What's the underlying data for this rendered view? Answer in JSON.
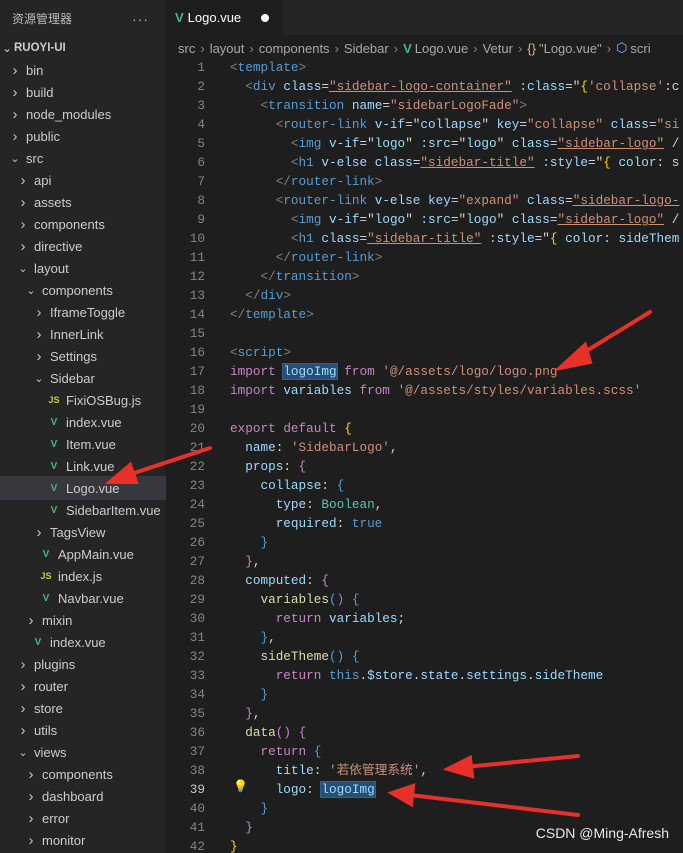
{
  "sidebar": {
    "title": "资源管理器",
    "more": "···",
    "root": "RUOYI-UI",
    "tree": [
      {
        "label": "bin",
        "depth": 1,
        "type": "folder"
      },
      {
        "label": "build",
        "depth": 1,
        "type": "folder"
      },
      {
        "label": "node_modules",
        "depth": 1,
        "type": "folder"
      },
      {
        "label": "public",
        "depth": 1,
        "type": "folder"
      },
      {
        "label": "src",
        "depth": 1,
        "type": "open"
      },
      {
        "label": "api",
        "depth": 2,
        "type": "folder"
      },
      {
        "label": "assets",
        "depth": 2,
        "type": "folder"
      },
      {
        "label": "components",
        "depth": 2,
        "type": "folder"
      },
      {
        "label": "directive",
        "depth": 2,
        "type": "folder"
      },
      {
        "label": "layout",
        "depth": 2,
        "type": "open"
      },
      {
        "label": "components",
        "depth": 3,
        "type": "open"
      },
      {
        "label": "IframeToggle",
        "depth": 4,
        "type": "folder"
      },
      {
        "label": "InnerLink",
        "depth": 4,
        "type": "folder"
      },
      {
        "label": "Settings",
        "depth": 4,
        "type": "folder"
      },
      {
        "label": "Sidebar",
        "depth": 4,
        "type": "open"
      },
      {
        "label": "FixiOSBug.js",
        "depth": 5,
        "type": "js"
      },
      {
        "label": "index.vue",
        "depth": 5,
        "type": "vue"
      },
      {
        "label": "Item.vue",
        "depth": 5,
        "type": "vue"
      },
      {
        "label": "Link.vue",
        "depth": 5,
        "type": "vue"
      },
      {
        "label": "Logo.vue",
        "depth": 5,
        "type": "vue",
        "selected": true
      },
      {
        "label": "SidebarItem.vue",
        "depth": 5,
        "type": "vue"
      },
      {
        "label": "TagsView",
        "depth": 4,
        "type": "folder"
      },
      {
        "label": "AppMain.vue",
        "depth": 4,
        "type": "vue"
      },
      {
        "label": "index.js",
        "depth": 4,
        "type": "js"
      },
      {
        "label": "Navbar.vue",
        "depth": 4,
        "type": "vue"
      },
      {
        "label": "mixin",
        "depth": 3,
        "type": "folder"
      },
      {
        "label": "index.vue",
        "depth": 3,
        "type": "vue"
      },
      {
        "label": "plugins",
        "depth": 2,
        "type": "folder"
      },
      {
        "label": "router",
        "depth": 2,
        "type": "folder"
      },
      {
        "label": "store",
        "depth": 2,
        "type": "folder"
      },
      {
        "label": "utils",
        "depth": 2,
        "type": "folder"
      },
      {
        "label": "views",
        "depth": 2,
        "type": "open"
      },
      {
        "label": "components",
        "depth": 3,
        "type": "folder"
      },
      {
        "label": "dashboard",
        "depth": 3,
        "type": "folder"
      },
      {
        "label": "error",
        "depth": 3,
        "type": "folder"
      },
      {
        "label": "monitor",
        "depth": 3,
        "type": "folder"
      }
    ]
  },
  "tab": {
    "label": "Logo.vue",
    "modified": true
  },
  "breadcrumb": [
    "src",
    "layout",
    "components",
    "Sidebar",
    "Logo.vue",
    "Vetur",
    "\"Logo.vue\"",
    "scri"
  ],
  "editor": {
    "current_line": 39,
    "lines": [
      [
        [
          "p",
          "<"
        ],
        [
          "t",
          "template"
        ],
        [
          "p",
          ">"
        ]
      ],
      [
        [
          "n",
          "  "
        ],
        [
          "p",
          "<"
        ],
        [
          "t",
          "div"
        ],
        [
          "n",
          " "
        ],
        [
          "a",
          "class"
        ],
        [
          "n",
          "="
        ],
        [
          "s",
          "\"sidebar-logo-container\"",
          "u"
        ],
        [
          "n",
          " "
        ],
        [
          "a",
          ":class"
        ],
        [
          "n",
          "=\""
        ],
        [
          "b",
          "{"
        ],
        [
          "s",
          "'collapse'"
        ],
        [
          "n",
          ":c"
        ]
      ],
      [
        [
          "n",
          "    "
        ],
        [
          "p",
          "<"
        ],
        [
          "t",
          "transition"
        ],
        [
          "n",
          " "
        ],
        [
          "a",
          "name"
        ],
        [
          "n",
          "="
        ],
        [
          "s",
          "\"sidebarLogoFade\""
        ],
        [
          "p",
          ">"
        ]
      ],
      [
        [
          "n",
          "      "
        ],
        [
          "p",
          "<"
        ],
        [
          "t",
          "router-link"
        ],
        [
          "n",
          " "
        ],
        [
          "a",
          "v-if"
        ],
        [
          "n",
          "=\""
        ],
        [
          "v",
          "collapse"
        ],
        [
          "n",
          "\" "
        ],
        [
          "a",
          "key"
        ],
        [
          "n",
          "="
        ],
        [
          "s",
          "\"collapse\""
        ],
        [
          "n",
          " "
        ],
        [
          "a",
          "class"
        ],
        [
          "n",
          "="
        ],
        [
          "s",
          "\"si"
        ]
      ],
      [
        [
          "n",
          "        "
        ],
        [
          "p",
          "<"
        ],
        [
          "t",
          "img"
        ],
        [
          "n",
          " "
        ],
        [
          "a",
          "v-if"
        ],
        [
          "n",
          "=\""
        ],
        [
          "v",
          "logo"
        ],
        [
          "n",
          "\" "
        ],
        [
          "a",
          ":src"
        ],
        [
          "n",
          "=\""
        ],
        [
          "v",
          "logo"
        ],
        [
          "n",
          "\" "
        ],
        [
          "a",
          "class"
        ],
        [
          "n",
          "="
        ],
        [
          "s",
          "\"sidebar-logo\"",
          "u"
        ],
        [
          "n",
          " /"
        ]
      ],
      [
        [
          "n",
          "        "
        ],
        [
          "p",
          "<"
        ],
        [
          "t",
          "h1"
        ],
        [
          "n",
          " "
        ],
        [
          "a",
          "v-else"
        ],
        [
          "n",
          " "
        ],
        [
          "a",
          "class"
        ],
        [
          "n",
          "="
        ],
        [
          "s",
          "\"sidebar-title\"",
          "u"
        ],
        [
          "n",
          " "
        ],
        [
          "a",
          ":style"
        ],
        [
          "n",
          "=\""
        ],
        [
          "b",
          "{"
        ],
        [
          "n",
          " "
        ],
        [
          "v",
          "color"
        ],
        [
          "n",
          ": s"
        ]
      ],
      [
        [
          "n",
          "      "
        ],
        [
          "p",
          "</"
        ],
        [
          "t",
          "router-link"
        ],
        [
          "p",
          ">"
        ]
      ],
      [
        [
          "n",
          "      "
        ],
        [
          "p",
          "<"
        ],
        [
          "t",
          "router-link"
        ],
        [
          "n",
          " "
        ],
        [
          "a",
          "v-else"
        ],
        [
          "n",
          " "
        ],
        [
          "a",
          "key"
        ],
        [
          "n",
          "="
        ],
        [
          "s",
          "\"expand\""
        ],
        [
          "n",
          " "
        ],
        [
          "a",
          "class"
        ],
        [
          "n",
          "="
        ],
        [
          "s",
          "\"sidebar-logo-",
          "u"
        ]
      ],
      [
        [
          "n",
          "        "
        ],
        [
          "p",
          "<"
        ],
        [
          "t",
          "img"
        ],
        [
          "n",
          " "
        ],
        [
          "a",
          "v-if"
        ],
        [
          "n",
          "=\""
        ],
        [
          "v",
          "logo"
        ],
        [
          "n",
          "\" "
        ],
        [
          "a",
          ":src"
        ],
        [
          "n",
          "=\""
        ],
        [
          "v",
          "logo"
        ],
        [
          "n",
          "\" "
        ],
        [
          "a",
          "class"
        ],
        [
          "n",
          "="
        ],
        [
          "s",
          "\"sidebar-logo\"",
          "u"
        ],
        [
          "n",
          " /"
        ]
      ],
      [
        [
          "n",
          "        "
        ],
        [
          "p",
          "<"
        ],
        [
          "t",
          "h1"
        ],
        [
          "n",
          " "
        ],
        [
          "a",
          "class"
        ],
        [
          "n",
          "="
        ],
        [
          "s",
          "\"sidebar-title\"",
          "u"
        ],
        [
          "n",
          " "
        ],
        [
          "a",
          ":style"
        ],
        [
          "n",
          "=\""
        ],
        [
          "b",
          "{"
        ],
        [
          "n",
          " "
        ],
        [
          "v",
          "color"
        ],
        [
          "n",
          ": "
        ],
        [
          "v",
          "sideThem"
        ]
      ],
      [
        [
          "n",
          "      "
        ],
        [
          "p",
          "</"
        ],
        [
          "t",
          "router-link"
        ],
        [
          "p",
          ">"
        ]
      ],
      [
        [
          "n",
          "    "
        ],
        [
          "p",
          "</"
        ],
        [
          "t",
          "transition"
        ],
        [
          "p",
          ">"
        ]
      ],
      [
        [
          "n",
          "  "
        ],
        [
          "p",
          "</"
        ],
        [
          "t",
          "div"
        ],
        [
          "p",
          ">"
        ]
      ],
      [
        [
          "p",
          "</"
        ],
        [
          "t",
          "template"
        ],
        [
          "p",
          ">"
        ]
      ],
      [],
      [
        [
          "p",
          "<"
        ],
        [
          "t",
          "script"
        ],
        [
          "p",
          ">"
        ]
      ],
      [
        [
          "k",
          "import"
        ],
        [
          "n",
          " "
        ],
        [
          "v",
          "logoImg",
          "hl"
        ],
        [
          "n",
          " "
        ],
        [
          "k",
          "from"
        ],
        [
          "n",
          " "
        ],
        [
          "s",
          "'@/assets/logo/logo.png'"
        ]
      ],
      [
        [
          "k",
          "import"
        ],
        [
          "n",
          " "
        ],
        [
          "v",
          "variables"
        ],
        [
          "n",
          " "
        ],
        [
          "k",
          "from"
        ],
        [
          "n",
          " "
        ],
        [
          "s",
          "'@/assets/styles/variables.scss'"
        ]
      ],
      [],
      [
        [
          "k",
          "export"
        ],
        [
          "n",
          " "
        ],
        [
          "k",
          "default"
        ],
        [
          "n",
          " "
        ],
        [
          "b",
          "{"
        ]
      ],
      [
        [
          "n",
          "  "
        ],
        [
          "v",
          "name"
        ],
        [
          "n",
          ": "
        ],
        [
          "s",
          "'SidebarLogo'"
        ],
        [
          "n",
          ","
        ]
      ],
      [
        [
          "n",
          "  "
        ],
        [
          "v",
          "props"
        ],
        [
          "n",
          ": "
        ],
        [
          "k",
          "{"
        ]
      ],
      [
        [
          "n",
          "    "
        ],
        [
          "v",
          "collapse"
        ],
        [
          "n",
          ": "
        ],
        [
          "t",
          "{"
        ]
      ],
      [
        [
          "n",
          "      "
        ],
        [
          "v",
          "type"
        ],
        [
          "n",
          ": "
        ],
        [
          "c",
          "Boolean"
        ],
        [
          "n",
          ","
        ]
      ],
      [
        [
          "n",
          "      "
        ],
        [
          "v",
          "required"
        ],
        [
          "n",
          ": "
        ],
        [
          "bl",
          "true"
        ]
      ],
      [
        [
          "n",
          "    "
        ],
        [
          "t",
          "}"
        ]
      ],
      [
        [
          "n",
          "  "
        ],
        [
          "k",
          "}"
        ],
        [
          "n",
          ","
        ]
      ],
      [
        [
          "n",
          "  "
        ],
        [
          "v",
          "computed"
        ],
        [
          "n",
          ": "
        ],
        [
          "k",
          "{"
        ]
      ],
      [
        [
          "n",
          "    "
        ],
        [
          "f",
          "variables"
        ],
        [
          "t",
          "()"
        ],
        [
          "n",
          " "
        ],
        [
          "t",
          "{"
        ]
      ],
      [
        [
          "n",
          "      "
        ],
        [
          "k",
          "return"
        ],
        [
          "n",
          " "
        ],
        [
          "v",
          "variables"
        ],
        [
          "n",
          ";"
        ]
      ],
      [
        [
          "n",
          "    "
        ],
        [
          "t",
          "}"
        ],
        [
          "n",
          ","
        ]
      ],
      [
        [
          "n",
          "    "
        ],
        [
          "f",
          "sideTheme"
        ],
        [
          "t",
          "()"
        ],
        [
          "n",
          " "
        ],
        [
          "t",
          "{"
        ]
      ],
      [
        [
          "n",
          "      "
        ],
        [
          "k",
          "return"
        ],
        [
          "n",
          " "
        ],
        [
          "bl",
          "this"
        ],
        [
          "n",
          "."
        ],
        [
          "v",
          "$store"
        ],
        [
          "n",
          "."
        ],
        [
          "v",
          "state"
        ],
        [
          "n",
          "."
        ],
        [
          "v",
          "settings"
        ],
        [
          "n",
          "."
        ],
        [
          "v",
          "sideTheme"
        ]
      ],
      [
        [
          "n",
          "    "
        ],
        [
          "t",
          "}"
        ]
      ],
      [
        [
          "n",
          "  "
        ],
        [
          "k",
          "}"
        ],
        [
          "n",
          ","
        ]
      ],
      [
        [
          "n",
          "  "
        ],
        [
          "f",
          "data"
        ],
        [
          "k",
          "()"
        ],
        [
          "n",
          " "
        ],
        [
          "k",
          "{"
        ]
      ],
      [
        [
          "n",
          "    "
        ],
        [
          "k",
          "return"
        ],
        [
          "n",
          " "
        ],
        [
          "t",
          "{"
        ]
      ],
      [
        [
          "n",
          "      "
        ],
        [
          "v",
          "title"
        ],
        [
          "n",
          ": "
        ],
        [
          "s",
          "'若依管理系统'"
        ],
        [
          "n",
          ","
        ]
      ],
      [
        [
          "n",
          "      "
        ],
        [
          "v",
          "logo"
        ],
        [
          "n",
          ": "
        ],
        [
          "v",
          "logoImg",
          "hl"
        ]
      ],
      [
        [
          "n",
          "    "
        ],
        [
          "t",
          "}"
        ]
      ],
      [
        [
          "n",
          "  "
        ],
        [
          "k",
          "}"
        ]
      ],
      [
        [
          "b",
          "}"
        ]
      ]
    ]
  },
  "watermark": "CSDN @Ming-Afresh",
  "colors": {
    "accent_arrow": "#e8302a",
    "vue": "#41b883",
    "js": "#cbcb41"
  }
}
